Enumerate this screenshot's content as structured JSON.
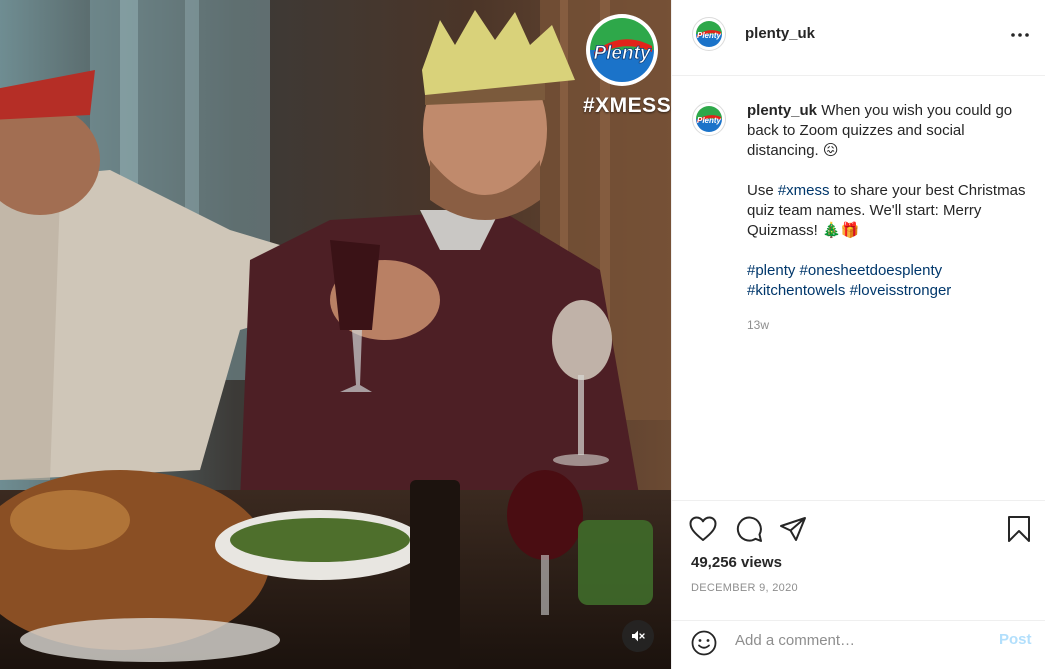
{
  "media": {
    "brand_logo_text": "Plenty",
    "overlay_tag": "#XMESS",
    "mute_icon": "speaker-muted-icon"
  },
  "header": {
    "username": "plenty_uk",
    "avatar_text": "Plenty",
    "more_icon": "more-horizontal-icon"
  },
  "caption": {
    "username": "plenty_uk",
    "line1": "When you wish you could go back to Zoom quizzes and social distancing. 😖",
    "line2_prefix": "Use ",
    "line2_hashtag": "#xmess",
    "line2_suffix": " to share your best Christmas quiz team names. We'll start: Merry Quizmass! 🎄🎁",
    "hashtags": [
      "#plenty",
      "#onesheetdoesplenty",
      "#kitchentowels",
      "#loveisstronger"
    ],
    "age": "13w"
  },
  "actions": {
    "views": "49,256 views",
    "date": "DECEMBER 9, 2020"
  },
  "comment": {
    "placeholder": "Add a comment…",
    "post_label": "Post"
  },
  "colors": {
    "link": "#00376b",
    "muted": "#8e8e8e",
    "post_disabled": "#b2dffc"
  }
}
